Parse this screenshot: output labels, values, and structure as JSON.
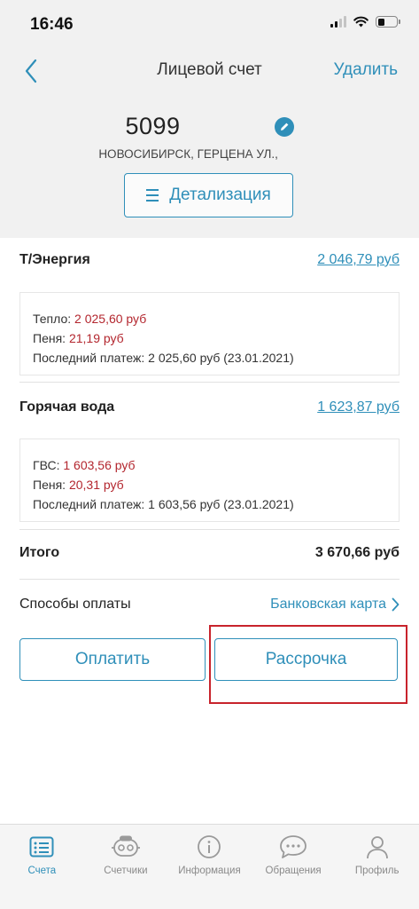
{
  "status_bar": {
    "time": "16:46"
  },
  "nav": {
    "title": "Лицевой счет",
    "delete_label": "Удалить"
  },
  "account": {
    "number_visible": "5099",
    "address": "НОВОСИБИРСК, ГЕРЦЕНА УЛ.,"
  },
  "detail_button": {
    "label": "Детализация"
  },
  "services": [
    {
      "name": "Т/Энергия",
      "amount": "2 046,79 руб",
      "lines": [
        {
          "label": "Тепло:",
          "value": "2 025,60 руб"
        },
        {
          "label": "Пеня:",
          "value": "21,19 руб"
        }
      ],
      "last_payment": "Последний платеж: 2 025,60 руб (23.01.2021)"
    },
    {
      "name": "Горячая вода",
      "amount": "1 623,87 руб",
      "lines": [
        {
          "label": "ГВС:",
          "value": "1 603,56 руб"
        },
        {
          "label": "Пеня:",
          "value": "20,31 руб"
        }
      ],
      "last_payment": "Последний платеж: 1 603,56 руб (23.01.2021)"
    }
  ],
  "total": {
    "label": "Итого",
    "amount": "3 670,66 руб"
  },
  "payment_methods": {
    "label": "Способы оплаты",
    "selected": "Банковская карта"
  },
  "actions": {
    "pay_label": "Оплатить",
    "installment_label": "Рассрочка"
  },
  "tabbar": {
    "items": [
      {
        "label": "Счета",
        "icon": "bills-icon",
        "active": true
      },
      {
        "label": "Счетчики",
        "icon": "meters-icon",
        "active": false
      },
      {
        "label": "Информация",
        "icon": "info-icon",
        "active": false
      },
      {
        "label": "Обращения",
        "icon": "chat-icon",
        "active": false
      },
      {
        "label": "Профиль",
        "icon": "profile-icon",
        "active": false
      }
    ]
  },
  "colors": {
    "accent": "#2f8fb9",
    "debt": "#b3262e",
    "highlight": "#c8232c",
    "header_bg": "#f1f1f1"
  }
}
